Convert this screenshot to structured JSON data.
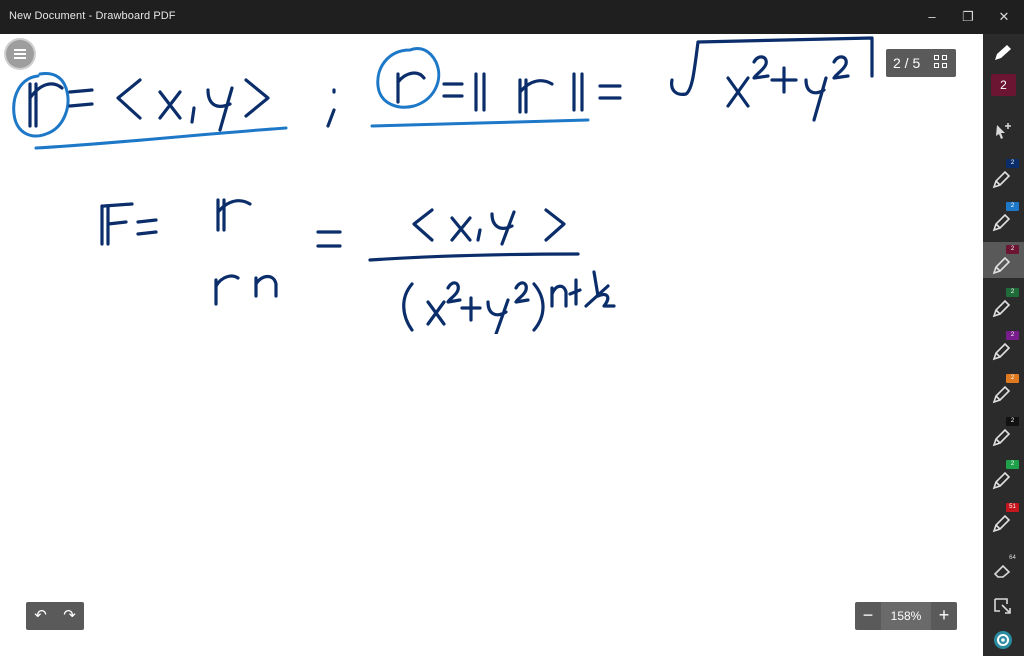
{
  "window": {
    "title": "New Document - Drawboard PDF",
    "minimize": "–",
    "restore": "❐",
    "close": "✕"
  },
  "page_indicator": {
    "text": "2 / 5"
  },
  "zoom": {
    "minus": "−",
    "value": "158%",
    "plus": "+"
  },
  "history": {
    "undo": "↶",
    "redo": "↷"
  },
  "toolbar": {
    "active_size": "2",
    "active_color": "#6b1533",
    "pens": [
      {
        "name": "pen-navy",
        "size": "2",
        "color": "#0b2e6b"
      },
      {
        "name": "pen-blue",
        "size": "2",
        "color": "#1e78c8"
      },
      {
        "name": "pen-maroon",
        "size": "2",
        "color": "#6b1533",
        "active": true
      },
      {
        "name": "pen-green",
        "size": "2",
        "color": "#1f6b3a"
      },
      {
        "name": "pen-purple",
        "size": "2",
        "color": "#7a1d8c"
      },
      {
        "name": "pen-orange",
        "size": "2",
        "color": "#e07a20"
      },
      {
        "name": "pen-black",
        "size": "2",
        "color": "#111111"
      },
      {
        "name": "pen-green-bright",
        "size": "2",
        "color": "#1fa04a"
      },
      {
        "name": "pen-red",
        "size": "51",
        "color": "#c4161c"
      }
    ],
    "eraser_size": "64"
  }
}
